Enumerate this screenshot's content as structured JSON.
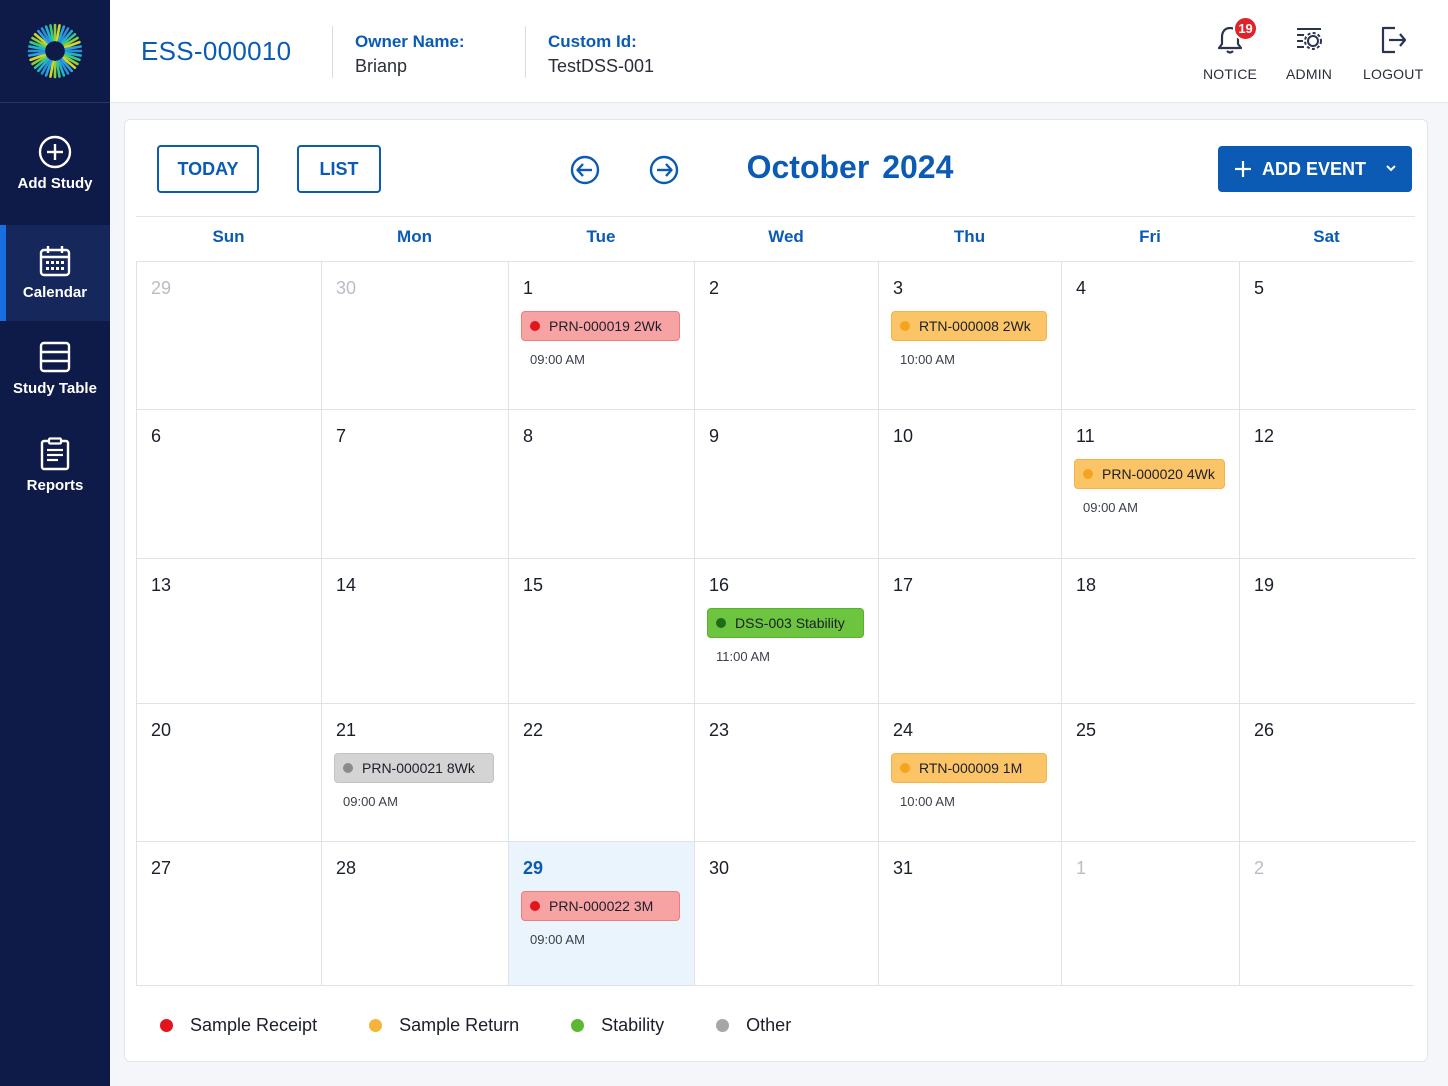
{
  "sidebar": {
    "items": [
      {
        "label": "Add Study"
      },
      {
        "label": "Calendar"
      },
      {
        "label": "Study Table"
      },
      {
        "label": "Reports"
      }
    ]
  },
  "header": {
    "study_id": "ESS-000010",
    "owner_label": "Owner Name:",
    "owner_value": "Brianp",
    "custom_label": "Custom Id:",
    "custom_value": "TestDSS-001",
    "notice_label": "NOTICE",
    "notice_count": "19",
    "admin_label": "ADMIN",
    "logout_label": "LOGOUT"
  },
  "toolbar": {
    "today_label": "TODAY",
    "list_label": "LIST",
    "month": "October",
    "year": "2024",
    "add_event_label": "ADD EVENT"
  },
  "weekdays": [
    "Sun",
    "Mon",
    "Tue",
    "Wed",
    "Thu",
    "Fri",
    "Sat"
  ],
  "weeks": [
    [
      {
        "day": "29",
        "muted": true
      },
      {
        "day": "30",
        "muted": true
      },
      {
        "day": "1",
        "events": [
          {
            "title": "PRN-000019 2Wk",
            "time": "09:00 AM",
            "type": "receipt"
          }
        ]
      },
      {
        "day": "2"
      },
      {
        "day": "3",
        "events": [
          {
            "title": "RTN-000008 2Wk",
            "time": "10:00 AM",
            "type": "return"
          }
        ]
      },
      {
        "day": "4"
      },
      {
        "day": "5"
      }
    ],
    [
      {
        "day": "6"
      },
      {
        "day": "7"
      },
      {
        "day": "8"
      },
      {
        "day": "9"
      },
      {
        "day": "10"
      },
      {
        "day": "11",
        "events": [
          {
            "title": "PRN-000020 4Wk",
            "time": "09:00 AM",
            "type": "return"
          }
        ]
      },
      {
        "day": "12"
      }
    ],
    [
      {
        "day": "13"
      },
      {
        "day": "14"
      },
      {
        "day": "15"
      },
      {
        "day": "16",
        "events": [
          {
            "title": "DSS-003 Stability",
            "time": "11:00 AM",
            "type": "stability"
          }
        ]
      },
      {
        "day": "17"
      },
      {
        "day": "18"
      },
      {
        "day": "19"
      }
    ],
    [
      {
        "day": "20"
      },
      {
        "day": "21",
        "events": [
          {
            "title": "PRN-000021 8Wk",
            "time": "09:00 AM",
            "type": "other"
          }
        ]
      },
      {
        "day": "22"
      },
      {
        "day": "23"
      },
      {
        "day": "24",
        "events": [
          {
            "title": "RTN-000009 1M",
            "time": "10:00 AM",
            "type": "return"
          }
        ]
      },
      {
        "day": "25"
      },
      {
        "day": "26"
      }
    ],
    [
      {
        "day": "27"
      },
      {
        "day": "28"
      },
      {
        "day": "29",
        "today": true,
        "events": [
          {
            "title": "PRN-000022 3M",
            "time": "09:00 AM",
            "type": "receipt"
          }
        ]
      },
      {
        "day": "30"
      },
      {
        "day": "31"
      },
      {
        "day": "1",
        "muted": true
      },
      {
        "day": "2",
        "muted": true
      }
    ]
  ],
  "event_types": {
    "receipt": {
      "label": "Sample Receipt",
      "dot": "#e3141c",
      "bg": "#f7a3a3",
      "border": "#ee7c7c"
    },
    "return": {
      "label": "Sample Return",
      "dot": "#f5a41f",
      "bg": "#fbc466",
      "border": "#f5b447"
    },
    "stability": {
      "label": "Stability",
      "dot": "#1f6b18",
      "bg": "#6cc43f",
      "border": "#58b02f"
    },
    "other": {
      "label": "Other",
      "dot": "#8c8c8c",
      "bg": "#d4d4d4",
      "border": "#c3c3c3"
    }
  },
  "legend": [
    {
      "label": "Sample Receipt",
      "color": "#e3141c"
    },
    {
      "label": "Sample Return",
      "color": "#f5b43a"
    },
    {
      "label": "Stability",
      "color": "#5cb82f"
    },
    {
      "label": "Other",
      "color": "#a6a6a6"
    }
  ]
}
